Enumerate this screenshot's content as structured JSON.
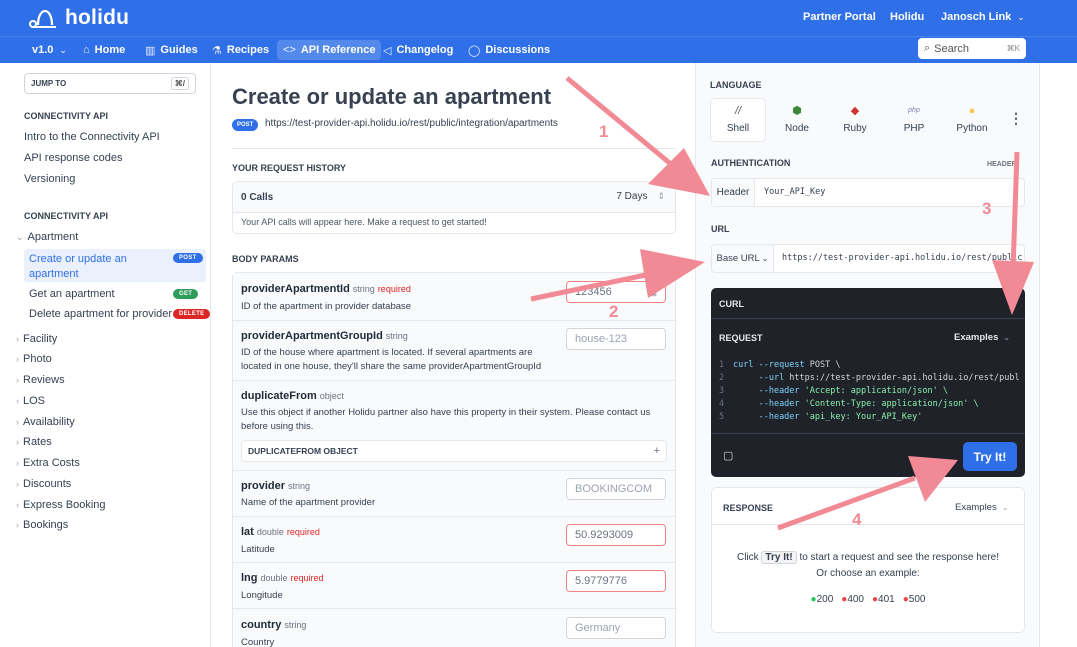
{
  "header": {
    "logo_text": "holidu",
    "partner_portal": "Partner Portal",
    "org": "Holidu",
    "user": "Janosch Link"
  },
  "nav": {
    "version": "v1.0",
    "items": [
      {
        "label": "Home",
        "icon": "home-icon"
      },
      {
        "label": "Guides",
        "icon": "book-icon"
      },
      {
        "label": "Recipes",
        "icon": "flask-icon"
      },
      {
        "label": "API Reference",
        "icon": "code-icon",
        "active": true
      },
      {
        "label": "Changelog",
        "icon": "megaphone-icon"
      },
      {
        "label": "Discussions",
        "icon": "chat-icon"
      }
    ],
    "search_placeholder": "Search",
    "search_shortcut": "⌘K"
  },
  "sidebar": {
    "jump_to": "JUMP TO",
    "jump_shortcut": "⌘/",
    "section1": "CONNECTIVITY API",
    "links": [
      "Intro to the Connectivity API",
      "API response codes",
      "Versioning"
    ],
    "section2": "CONNECTIVITY API",
    "apartment_folder": "Apartment",
    "apartment_items": [
      {
        "label": "Create or update an",
        "label2": "apartment",
        "badge": "POST",
        "color": "#2f6fe8"
      },
      {
        "label": "Get an apartment",
        "badge": "GET",
        "color": "#2e9d5b"
      },
      {
        "label": "Delete apartment for provider",
        "badge": "DELETE",
        "color": "#dc2626"
      }
    ],
    "folders": [
      "Facility",
      "Photo",
      "Reviews",
      "LOS",
      "Availability",
      "Rates",
      "Extra Costs",
      "Discounts",
      "Express Booking",
      "Bookings"
    ]
  },
  "main": {
    "title": "Create or update an apartment",
    "method": "POST",
    "url": "https://test-provider-api.holidu.io/rest/public/integration/apartments",
    "history_heading": "YOUR REQUEST HISTORY",
    "calls": "0 Calls",
    "range": "7 Days",
    "history_empty": "Your API calls will appear here. Make a request to get started!",
    "body_params_heading": "BODY PARAMS",
    "params": [
      {
        "name": "providerApartmentId",
        "type": "string",
        "required": "required",
        "desc": "ID of the apartment in provider database",
        "value": "123456"
      },
      {
        "name": "providerApartmentGroupId",
        "type": "string",
        "required": "",
        "desc": "ID of the house where apartment is located. If several apartments are",
        "desc2": "located in one house, they'll share the same providerApartmentGroupId",
        "value": "house-123"
      },
      {
        "name": "duplicateFrom",
        "type": "object",
        "required": "",
        "desc": "Use this object if another Holidu partner also have this property in their system. Please contact us",
        "desc2": "before using this.",
        "sub": "DUPLICATEFROM OBJECT"
      },
      {
        "name": "provider",
        "type": "string",
        "required": "",
        "desc": "Name of the apartment provider",
        "value": "BOOKINGCOM"
      },
      {
        "name": "lat",
        "type": "double",
        "required": "required",
        "desc": "Latitude",
        "value": "50.9293009"
      },
      {
        "name": "lng",
        "type": "double",
        "required": "required",
        "desc": "Longitude",
        "value": "5.9779776"
      },
      {
        "name": "country",
        "type": "string",
        "required": "",
        "desc": "Country",
        "value": "Germany"
      }
    ]
  },
  "right": {
    "language_heading": "LANGUAGE",
    "languages": [
      {
        "label": "Shell",
        "icon": "shell-icon",
        "glyph": "//"
      },
      {
        "label": "Node",
        "icon": "node-icon",
        "glyph": "⬢"
      },
      {
        "label": "Ruby",
        "icon": "ruby-icon",
        "glyph": "◆"
      },
      {
        "label": "PHP",
        "icon": "php-icon",
        "glyph": "php"
      },
      {
        "label": "Python",
        "icon": "python-icon",
        "glyph": "●"
      }
    ],
    "auth_heading": "AUTHENTICATION",
    "auth_right": "HEADER",
    "auth_label": "Header",
    "auth_value": "Your_API_Key",
    "url_heading": "URL",
    "base_url_label": "Base URL",
    "base_url_value": "https://test-provider-api.holidu.io/rest/public",
    "curl_heading": "CURL",
    "request_label": "REQUEST",
    "examples": "Examples",
    "code": [
      {
        "n": "1",
        "a": "curl ",
        "b": "--request",
        "c": " POST \\"
      },
      {
        "n": "2",
        "a": "     ",
        "b": "--url",
        "c": " https://test-provider-api.holidu.io/rest/publ"
      },
      {
        "n": "3",
        "a": "     ",
        "b": "--header",
        "c": " 'Accept: application/json' \\"
      },
      {
        "n": "4",
        "a": "     ",
        "b": "--header",
        "c": " 'Content-Type: application/json' \\"
      },
      {
        "n": "5",
        "a": "     ",
        "b": "--header",
        "c": " 'api_key: Your_API_Key'"
      }
    ],
    "try_it": "Try It!",
    "response_heading": "RESPONSE",
    "response_examples": "Examples",
    "response_hint_pre": "Click",
    "response_hint_btn": "Try It!",
    "response_hint_post": "to start a request and see the response here!",
    "response_hint2": "Or choose an example:",
    "codes": [
      {
        "code": "200",
        "color": "#22c55e"
      },
      {
        "code": "400",
        "color": "#ef4444"
      },
      {
        "code": "401",
        "color": "#ef4444"
      },
      {
        "code": "500",
        "color": "#ef4444"
      }
    ]
  },
  "annotations": {
    "n1": "1",
    "n2": "2",
    "n3": "3",
    "n4": "4",
    "color": "#f28a96"
  }
}
